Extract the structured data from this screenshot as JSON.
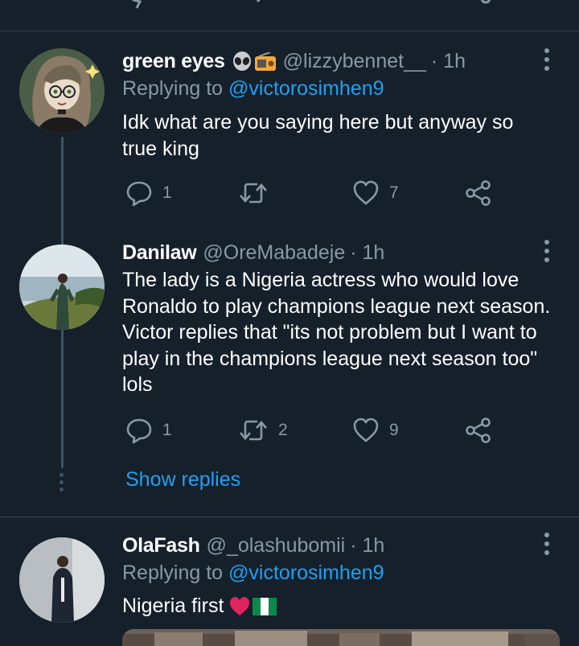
{
  "tweets": [
    {
      "name": "green eyes",
      "name_emojis": [
        "alien-emoji",
        "radio-emoji"
      ],
      "handle": "@lizzybennet__",
      "time": "· 1h",
      "replying_label": "Replying to",
      "replying_to": "@victorosimhen9",
      "text": "Idk what are you saying here but anyway so true king",
      "replies": "1",
      "retweets": "",
      "likes": "7"
    },
    {
      "name": "Danilaw",
      "handle": "@OreMabadeje",
      "time": "· 1h",
      "text": "The lady is a Nigeria actress who would love Ronaldo to play champions league next season. Victor replies that \"its not problem but I want to play in the champions league next season too\" lols",
      "replies": "1",
      "retweets": "2",
      "likes": "9"
    },
    {
      "name": "OlaFash",
      "handle": "@_olashubomii",
      "time": "· 1h",
      "replying_label": "Replying to",
      "replying_to": "@victorosimhen9",
      "text": "Nigeria first",
      "text_emojis": [
        "red-heart-emoji",
        "nigeria-flag-emoji"
      ]
    }
  ],
  "show_replies_label": "Show replies",
  "colors": {
    "background": "#15202b",
    "divider": "#38444d",
    "secondary_text": "#8899a6",
    "link": "#1da1f2"
  }
}
